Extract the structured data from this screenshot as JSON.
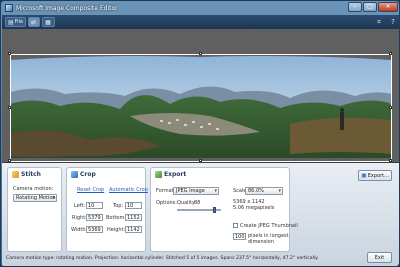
{
  "window": {
    "title": "Microsoft Image Composite Editor"
  },
  "window_controls": {
    "minimize": "–",
    "maximize": "□",
    "close": "✕"
  },
  "toolbar": {
    "file_label": "File",
    "help_glyph": "?"
  },
  "stitch": {
    "title": "Stitch",
    "camera_motion_label": "Camera motion:",
    "camera_motion_value": "Rotating Motion"
  },
  "crop": {
    "title": "Crop",
    "reset_crop": "Reset Crop",
    "automatic_crop": "Automatic Crop",
    "left_label": "Left:",
    "left_value": "10",
    "top_label": "Top:",
    "top_value": "10",
    "right_label": "Right:",
    "right_value": "5379",
    "bottom_label": "Bottom:",
    "bottom_value": "1152",
    "width_label": "Width:",
    "width_value": "5369",
    "height_label": "Height:",
    "height_value": "1142"
  },
  "export": {
    "title": "Export",
    "format_label": "Format:",
    "format_value": "JPEG Image",
    "options_label": "Options:",
    "quality_label": "Quality:",
    "quality_value": "88",
    "quality_fraction": 0.88,
    "scale_label": "Scale:",
    "scale_value": "86.0%",
    "dimensions": "5369 x 1142",
    "megapixels": "5.06 megapixels",
    "create_thumbnail_label": "Create JPEG Thumbnail",
    "thumb_value": "100",
    "thumb_note_line1": "pixels in longest",
    "thumb_note_line2": "dimension",
    "export_button": "Export...",
    "exit_button": "Exit"
  },
  "status": {
    "text": "Camera motion type: rotating motion. Projection: horizontal cylinder. Stitched 5 of 5 images. Spans 237.5° horizontally, 47.2° vertically."
  },
  "colors": {
    "accent": "#1f5fbf",
    "window_frame": "#3f6a90",
    "canvas": "#606060"
  }
}
